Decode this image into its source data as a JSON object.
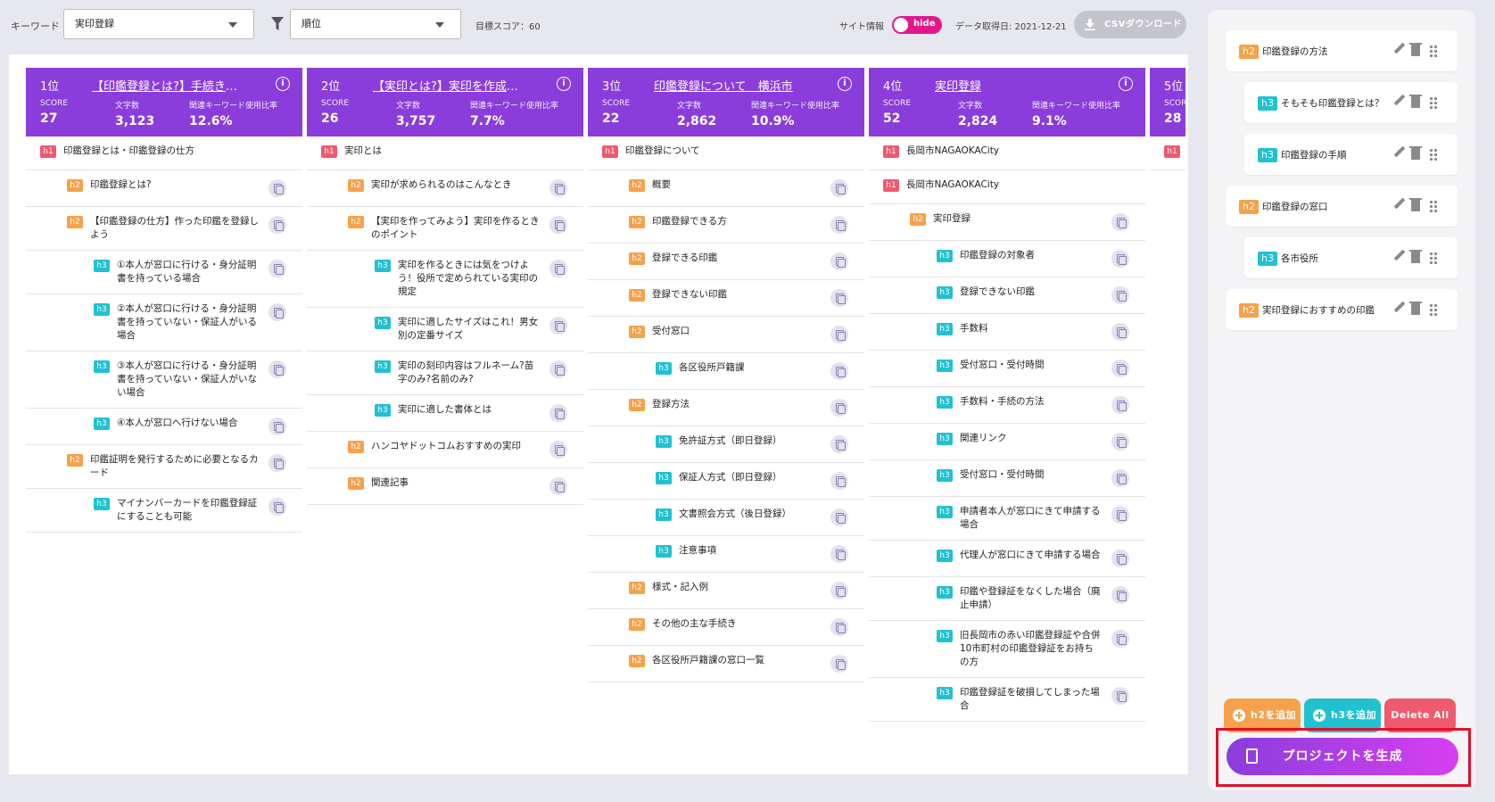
{
  "toolbar": {
    "keyword_label": "キーワード",
    "keyword_value": "実印登録",
    "sort_value": "順位",
    "target_score": "目標スコア：60",
    "site_info_label": "サイト情報",
    "toggle_label": "hide",
    "fetch_date": "データ取得日: 2021-12-21",
    "csv_label": "CSVダウンロード"
  },
  "stat_labels": {
    "score": "SCORE",
    "chars": "文字数",
    "ratio": "関連キーワード使用比率"
  },
  "columns": [
    {
      "rank": "1位",
      "title": "【印鑑登録とは?】手続き方...",
      "score": "27",
      "chars": "3,123",
      "ratio": "12.6%",
      "headings": [
        {
          "level": "h1",
          "text": "印鑑登録とは・印鑑登録の仕方"
        },
        {
          "level": "h2",
          "text": "印鑑登録とは?"
        },
        {
          "level": "h2",
          "text": "【印鑑登録の仕方】作った印鑑を登録しよう"
        },
        {
          "level": "h3",
          "text": "①本人が窓口に行ける・身分証明書を持っている場合"
        },
        {
          "level": "h3",
          "text": "②本人が窓口に行ける・身分証明書を持っていない・保証人がいる場合"
        },
        {
          "level": "h3",
          "text": "③本人が窓口に行ける・身分証明書を持っていない・保証人がいない場合"
        },
        {
          "level": "h3",
          "text": "④本人が窓口へ行けない場合"
        },
        {
          "level": "h2",
          "text": "印鑑証明を発行するために必要となるカード"
        },
        {
          "level": "h3",
          "text": "マイナンバーカードを印鑑登録証にすることも可能"
        }
      ]
    },
    {
      "rank": "2位",
      "title": "【実印とは?】実印を作成す...",
      "score": "26",
      "chars": "3,757",
      "ratio": "7.7%",
      "headings": [
        {
          "level": "h1",
          "text": "実印とは"
        },
        {
          "level": "h2",
          "text": "実印が求められるのはこんなとき"
        },
        {
          "level": "h2",
          "text": "【実印を作ってみよう】実印を作るときのポイント"
        },
        {
          "level": "h3",
          "text": "実印を作るときには気をつけよう！役所で定められている実印の規定"
        },
        {
          "level": "h3",
          "text": "実印に適したサイズはこれ！男女別の定番サイズ"
        },
        {
          "level": "h3",
          "text": "実印の刻印内容はフルネーム?苗字のみ?名前のみ?"
        },
        {
          "level": "h3",
          "text": "実印に適した書体とは"
        },
        {
          "level": "h2",
          "text": "ハンコヤドットコムおすすめの実印"
        },
        {
          "level": "h2",
          "text": "関連記事"
        }
      ]
    },
    {
      "rank": "3位",
      "title": "印鑑登録について　横浜市",
      "score": "22",
      "chars": "2,862",
      "ratio": "10.9%",
      "headings": [
        {
          "level": "h1",
          "text": "印鑑登録について"
        },
        {
          "level": "h2",
          "text": "概要"
        },
        {
          "level": "h2",
          "text": "印鑑登録できる方"
        },
        {
          "level": "h2",
          "text": "登録できる印鑑"
        },
        {
          "level": "h2",
          "text": "登録できない印鑑"
        },
        {
          "level": "h2",
          "text": "受付窓口"
        },
        {
          "level": "h3",
          "text": "各区役所戸籍課"
        },
        {
          "level": "h2",
          "text": "登録方法"
        },
        {
          "level": "h3",
          "text": "免許証方式（即日登録）"
        },
        {
          "level": "h3",
          "text": "保証人方式（即日登録）"
        },
        {
          "level": "h3",
          "text": "文書照会方式（後日登録）"
        },
        {
          "level": "h3",
          "text": "注意事項"
        },
        {
          "level": "h2",
          "text": "様式・記入例"
        },
        {
          "level": "h2",
          "text": "その他の主な手続き"
        },
        {
          "level": "h2",
          "text": "各区役所戸籍課の窓口一覧"
        }
      ]
    },
    {
      "rank": "4位",
      "title": "実印登録",
      "score": "52",
      "chars": "2,824",
      "ratio": "9.1%",
      "headings": [
        {
          "level": "h1",
          "text": "長岡市NAGAOKACity"
        },
        {
          "level": "h1",
          "text": "長岡市NAGAOKACity"
        },
        {
          "level": "h2",
          "text": "実印登録"
        },
        {
          "level": "h3",
          "text": "印鑑登録の対象者"
        },
        {
          "level": "h3",
          "text": "登録できない印鑑"
        },
        {
          "level": "h3",
          "text": "手数料"
        },
        {
          "level": "h3",
          "text": "受付窓口・受付時間"
        },
        {
          "level": "h3",
          "text": "手数料・手続の方法"
        },
        {
          "level": "h3",
          "text": "関連リンク"
        },
        {
          "level": "h3",
          "text": "受付窓口・受付時間"
        },
        {
          "level": "h3",
          "text": "申請者本人が窓口にきて申請する場合"
        },
        {
          "level": "h3",
          "text": "代理人が窓口にきて申請する場合"
        },
        {
          "level": "h3",
          "text": "印鑑や登録証をなくした場合（廃止申請）"
        },
        {
          "level": "h3",
          "text": "旧長岡市の赤い印鑑登録証や合併10市町村の印鑑登録証をお持ちの方"
        },
        {
          "level": "h3",
          "text": "印鑑登録証を破損してしまった場合"
        }
      ]
    },
    {
      "rank": "5位",
      "title": "",
      "score": "28",
      "chars": "",
      "ratio": "",
      "headings": [
        {
          "level": "h1",
          "text": ""
        }
      ]
    }
  ],
  "outline": [
    {
      "level": "h2",
      "text": "印鑑登録の方法"
    },
    {
      "level": "h3",
      "text": "そもそも印鑑登録とは？"
    },
    {
      "level": "h3",
      "text": "印鑑登録の手順"
    },
    {
      "level": "h2",
      "text": "印鑑登録の窓口"
    },
    {
      "level": "h3",
      "text": "各市役所"
    },
    {
      "level": "h2",
      "text": "実印登録におすすめの印鑑"
    }
  ],
  "actions": {
    "add_h2": "h2を追加",
    "add_h3": "h3を追加",
    "delete_all": "Delete All",
    "generate": "プロジェクトを生成"
  },
  "colors": {
    "header": "#8a3ddb",
    "h1": "#ef5a6f",
    "h2": "#f6a14b",
    "h3": "#21c1d1",
    "toggle": "#e0188b",
    "highlight": "#e0102a"
  }
}
